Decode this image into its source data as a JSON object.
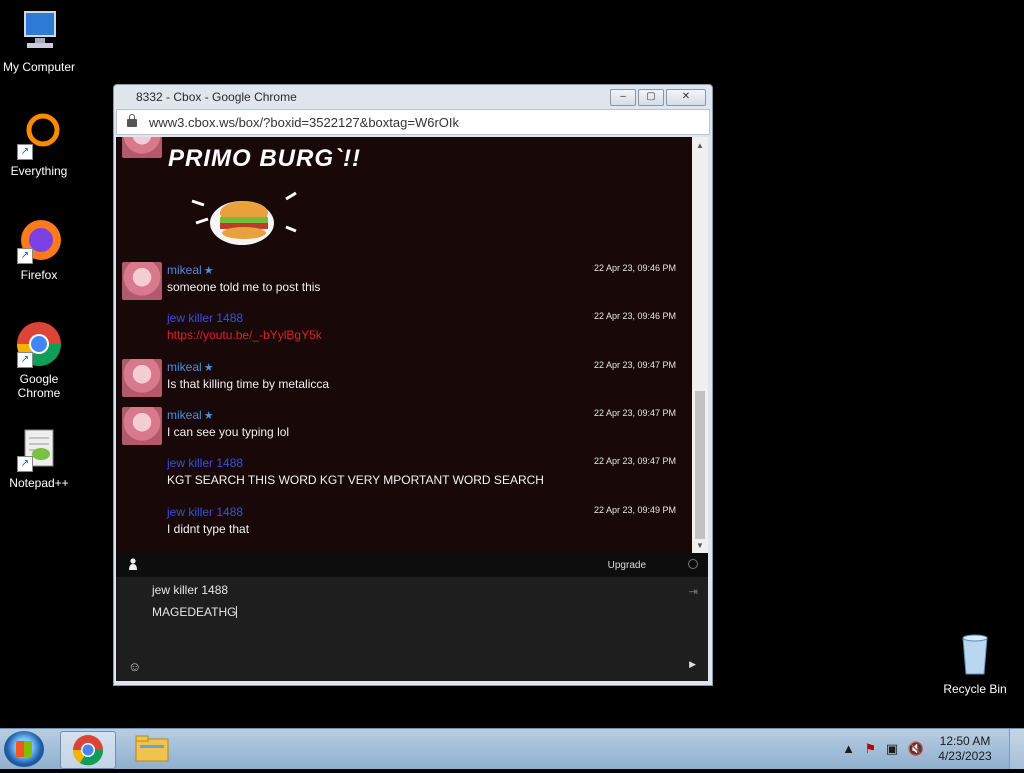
{
  "desktop": {
    "icons": [
      {
        "label": "My Computer",
        "icon": "computer-icon"
      },
      {
        "label": "Everything",
        "icon": "everything-icon"
      },
      {
        "label": "Firefox",
        "icon": "firefox-icon"
      },
      {
        "label": "Google Chrome",
        "icon": "chrome-icon"
      },
      {
        "label": "Notepad++",
        "icon": "notepadpp-icon"
      },
      {
        "label": "Recycle Bin",
        "icon": "recycle-bin-icon"
      }
    ]
  },
  "window": {
    "title": "8332 - Cbox - Google Chrome",
    "url": "www3.cbox.ws/box/?boxid=3522127&boxtag=W6rOIk",
    "buttons": {
      "minimize": "‒",
      "maximize": "▢",
      "close": "✕"
    }
  },
  "chat": {
    "banner_text": "PRIMO BURG`!!",
    "messages": [
      {
        "user": "mikeal",
        "verified": true,
        "time": "22 Apr 23, 09:46 PM",
        "text": "someone told me to post this",
        "is_link": false,
        "has_avatar": true
      },
      {
        "user": "jew killer 1488",
        "verified": false,
        "time": "22 Apr 23, 09:46 PM",
        "text": "https://youtu.be/_-bYylBgY5k",
        "is_link": true,
        "has_avatar": false
      },
      {
        "user": "mikeal",
        "verified": true,
        "time": "22 Apr 23, 09:47 PM",
        "text": "Is that killing time by metalicca",
        "is_link": false,
        "has_avatar": true
      },
      {
        "user": "mikeal",
        "verified": true,
        "time": "22 Apr 23, 09:47 PM",
        "text": "I can see you typing lol",
        "is_link": false,
        "has_avatar": true
      },
      {
        "user": "jew killer 1488",
        "verified": false,
        "time": "22 Apr 23, 09:47 PM",
        "text": "KGT SEARCH THIS WORD KGT VERY MPORTANT WORD SEARCH",
        "is_link": false,
        "has_avatar": false
      },
      {
        "user": "jew killer 1488",
        "verified": false,
        "time": "22 Apr 23, 09:49 PM",
        "text": "I didnt type that",
        "is_link": false,
        "has_avatar": false
      }
    ],
    "upgrade_label": "Upgrade",
    "compose": {
      "username": "jew killer 1488",
      "input_value": "MAGEDEATHG"
    }
  },
  "colors": {
    "chat_bg": "#180808",
    "user_link": "#3a4fd9",
    "mod_user": "#4a8fe0",
    "link_red": "#d9252a"
  },
  "taskbar": {
    "clock_time": "12:50 AM",
    "clock_date": "4/23/2023",
    "pinned": [
      "chrome-icon",
      "explorer-icon"
    ]
  }
}
